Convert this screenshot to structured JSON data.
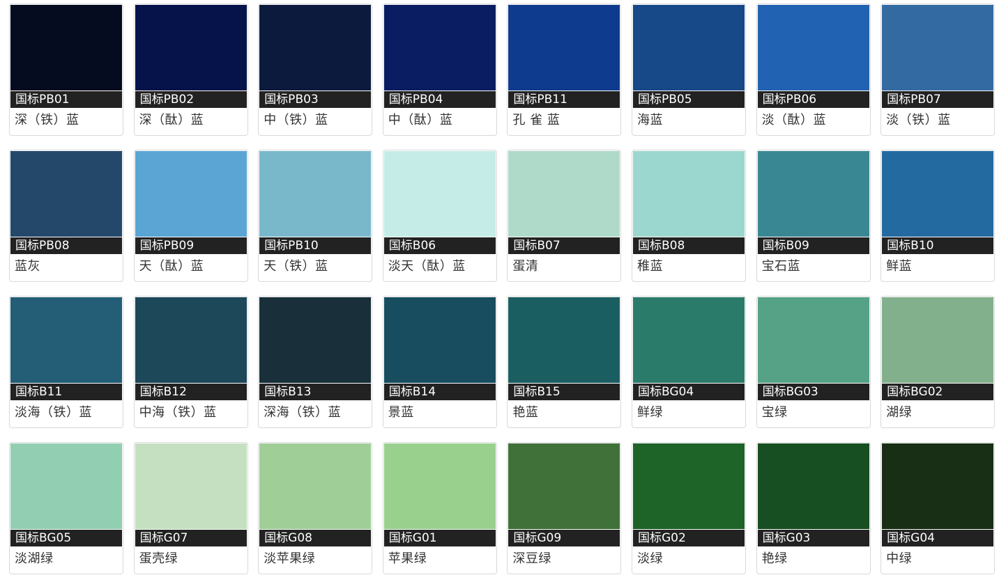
{
  "swatches": [
    {
      "code": "国标PB01",
      "name": "深（铁）蓝",
      "color": "#050c1f"
    },
    {
      "code": "国标PB02",
      "name": "深（酞）蓝",
      "color": "#06134a"
    },
    {
      "code": "国标PB03",
      "name": "中（铁）蓝",
      "color": "#0b1a3d"
    },
    {
      "code": "国标PB04",
      "name": "中（酞）蓝",
      "color": "#0a1d63"
    },
    {
      "code": "国标PB11",
      "name": "孔 雀 蓝",
      "color": "#0f3b8f"
    },
    {
      "code": "国标PB05",
      "name": "海蓝",
      "color": "#174888"
    },
    {
      "code": "国标PB06",
      "name": "淡（酞）蓝",
      "color": "#2262b2"
    },
    {
      "code": "国标PB07",
      "name": "淡（铁）蓝",
      "color": "#346aa2"
    },
    {
      "code": "国标PB08",
      "name": "蓝灰",
      "color": "#24486a"
    },
    {
      "code": "国标PB09",
      "name": "天（酞）蓝",
      "color": "#5aa5d4"
    },
    {
      "code": "国标PB10",
      "name": "天（铁）蓝",
      "color": "#79b8cb"
    },
    {
      "code": "国标B06",
      "name": "淡天（酞）蓝",
      "color": "#c5ece6"
    },
    {
      "code": "国标B07",
      "name": "蛋清",
      "color": "#afdac9"
    },
    {
      "code": "国标B08",
      "name": "稚蓝",
      "color": "#9cd7cf"
    },
    {
      "code": "国标B09",
      "name": "宝石蓝",
      "color": "#3a8794"
    },
    {
      "code": "国标B10",
      "name": "鲜蓝",
      "color": "#236aa0"
    },
    {
      "code": "国标B11",
      "name": "淡海（铁）蓝",
      "color": "#235d76"
    },
    {
      "code": "国标B12",
      "name": "中海（铁）蓝",
      "color": "#1c4859"
    },
    {
      "code": "国标B13",
      "name": "深海（铁）蓝",
      "color": "#19303a"
    },
    {
      "code": "国标B14",
      "name": "景蓝",
      "color": "#174d5f"
    },
    {
      "code": "国标B15",
      "name": "艳蓝",
      "color": "#1a5e62"
    },
    {
      "code": "国标BG04",
      "name": "鲜绿",
      "color": "#2b7b6a"
    },
    {
      "code": "国标BG03",
      "name": "宝绿",
      "color": "#55a286"
    },
    {
      "code": "国标BG02",
      "name": "湖绿",
      "color": "#82b08c"
    },
    {
      "code": "国标BG05",
      "name": "淡湖绿",
      "color": "#92ceb1"
    },
    {
      "code": "国标G07",
      "name": "蛋壳绿",
      "color": "#c4e0c0"
    },
    {
      "code": "国标G08",
      "name": "淡苹果绿",
      "color": "#9fce97"
    },
    {
      "code": "国标G01",
      "name": "苹果绿",
      "color": "#9ad08e"
    },
    {
      "code": "国标G09",
      "name": "深豆绿",
      "color": "#3f7138"
    },
    {
      "code": "国标G02",
      "name": "淡绿",
      "color": "#1e6328"
    },
    {
      "code": "国标G03",
      "name": "艳绿",
      "color": "#184f22"
    },
    {
      "code": "国标G04",
      "name": "中绿",
      "color": "#182f15"
    }
  ]
}
